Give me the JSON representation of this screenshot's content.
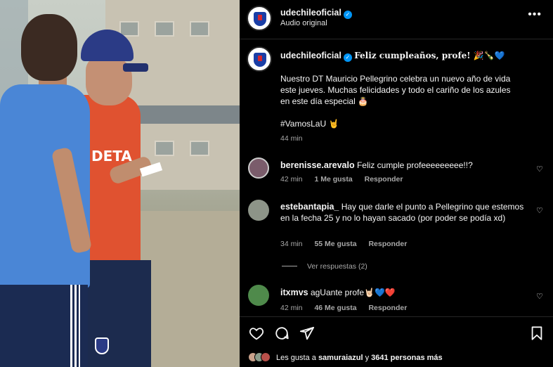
{
  "post_header": {
    "username": "udechileoficial",
    "subtitle": "Audio original",
    "more_icon": "more-horizontal-icon"
  },
  "caption": {
    "username": "udechileoficial",
    "title": "Feliz cumpleaños, profe! 🎉🍾💙",
    "body": "Nuestro DT Mauricio Pellegrino celebra un nuevo año de vida este jueves. Muchas felicidades y todo el cariño de los azules en este día especial 🎂",
    "hashtag": "#VamosLaU 🤘",
    "time": "44 min"
  },
  "photo_text": {
    "shirt": "DETA"
  },
  "comments": [
    {
      "username": "berenisse.arevalo",
      "text": "Feliz cumple profeeeeeeeee!!?",
      "time": "42 min",
      "likes": "1 Me gusta",
      "reply": "Responder",
      "avatar_color": "#7a5c6b"
    },
    {
      "username": "estebantapia_",
      "text": "Hay que darle el punto a Pellegrino que estemos en la fecha 25 y no lo hayan sacado (por poder se podía xd)",
      "time": "34 min",
      "likes": "55 Me gusta",
      "reply": "Responder",
      "avatar_color": "#8d9488",
      "view_replies": "Ver respuestas (2)"
    },
    {
      "username": "itxmvs",
      "text": "agUante profe🤘🏻💙❤️",
      "time": "42 min",
      "likes": "46 Me gusta",
      "reply": "Responder",
      "avatar_color": "#4f8a4b"
    }
  ],
  "actions": {
    "icons": [
      "heart-icon",
      "comment-icon",
      "share-icon",
      "bookmark-icon"
    ],
    "likes_prefix": "Les gusta a ",
    "likes_user": "samuraiazul",
    "likes_middle": " y ",
    "likes_count": "3641 personas más"
  },
  "colors": {
    "background": "#000000",
    "verified": "#0095f6",
    "muted": "#a8a8a8",
    "club_blue": "#1a3ea6",
    "club_red": "#d7262e"
  }
}
